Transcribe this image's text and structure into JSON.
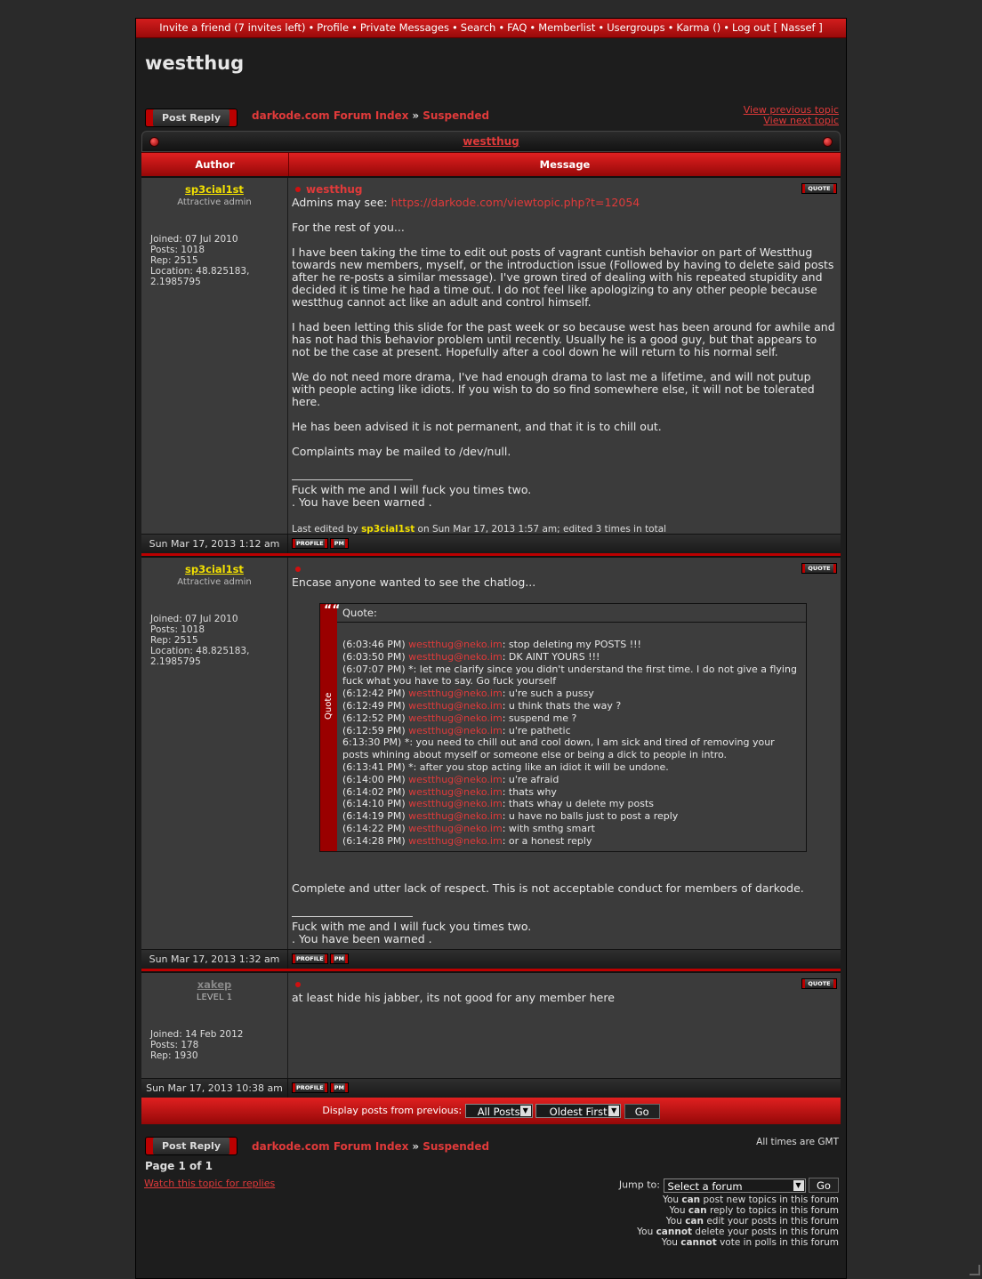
{
  "topnav": {
    "items": [
      "Invite a friend (7 invites left)",
      "Profile",
      "Private Messages",
      "Search",
      "FAQ",
      "Memberlist",
      "Usergroups",
      "Karma ()",
      "Log out [ Nassef ]"
    ]
  },
  "page_title": "westthug",
  "post_reply_label": "Post Reply",
  "breadcrumb": {
    "index": "darkode.com Forum Index",
    "forum": "Suspended",
    "sep": "»"
  },
  "nav": {
    "prev": "View previous topic",
    "next": "View next topic"
  },
  "topic_title": "westthug",
  "columns": {
    "author": "Author",
    "message": "Message"
  },
  "quote_btn": "QUOTE",
  "profile_btn": "PROFILE",
  "pm_btn": "PM",
  "posts": [
    {
      "author": "sp3cial1st",
      "rank": "Attractive admin",
      "joined": "Joined: 07 Jul 2010",
      "posts": "Posts: 1018",
      "rep": "Rep: 2515",
      "location1": "Location: 48.825183,",
      "location2": "2.1985795",
      "subject": "westthug",
      "admins_prefix": "Admins may see: ",
      "admins_link": "https://darkode.com/viewtopic.php?t=12054",
      "p1": "For the rest of you...",
      "p2": "I have been taking the time to edit out posts of vagrant cuntish behavior on part of Westthug towards new members, myself, or the introduction issue (Followed by having to delete said posts after he re-posts a similar message). I've grown tired of dealing with his repeated stupidity and decided it is time he had a time out. I do not feel like apologizing to any other people because westthug cannot act like an adult and control himself.",
      "p3": "I had been letting this slide for the past week or so because west has been around for awhile and has not had this behavior problem until recently. Usually he is a good guy, but that appears to not be the case at present. Hopefully after a cool down he will return to his normal self.",
      "p4": "We do not need more drama, I've had enough drama to last me a lifetime, and will not putup with people acting like idiots. If you wish to do so find somewhere else, it will not be tolerated here.",
      "p5": "He has been advised it is not permanent, and that it is to chill out.",
      "p6": "Complaints may be mailed to /dev/null.",
      "sig1": "Fuck with me and I will fuck you times two.",
      "sig2": ". You have been warned .",
      "edit_prefix": "Last edited by ",
      "edit_user": "sp3cial1st",
      "edit_suffix": " on Sun Mar 17, 2013 1:57 am; edited 3 times in total",
      "date": "Sun Mar 17, 2013 1:12 am"
    },
    {
      "author": "sp3cial1st",
      "rank": "Attractive admin",
      "joined": "Joined: 07 Jul 2010",
      "posts": "Posts: 1018",
      "rep": "Rep: 2515",
      "location1": "Location: 48.825183,",
      "location2": "2.1985795",
      "intro": "Encase anyone wanted to see the chatlog...",
      "quote_head": "Quote:",
      "quote_side": "Quote",
      "quote_mark": "““",
      "chat": [
        {
          "t": "(6:03:46 PM) ",
          "n": "westthug@neko.im",
          "m": ": stop deleting my POSTS !!!"
        },
        {
          "t": "(6:03:50 PM) ",
          "n": "westthug@neko.im",
          "m": ": DK AINT YOURS !!!"
        },
        {
          "t": "(6:07:07 PM) *: let me clarify since you didn't understand the first time. I do not give a flying fuck what you have to say. Go fuck yourself",
          "n": "",
          "m": ""
        },
        {
          "t": "(6:12:42 PM) ",
          "n": "westthug@neko.im",
          "m": ": u're such a pussy"
        },
        {
          "t": "(6:12:49 PM) ",
          "n": "westthug@neko.im",
          "m": ": u think thats the way ?"
        },
        {
          "t": "(6:12:52 PM) ",
          "n": "westthug@neko.im",
          "m": ": suspend me ?"
        },
        {
          "t": "(6:12:59 PM) ",
          "n": "westthug@neko.im",
          "m": ": u're pathetic"
        },
        {
          "t": "6:13:30 PM) *: you need to chill out and cool down, I am sick and tired of removing your posts whining about myself or someone else or being a dick to people in intro.",
          "n": "",
          "m": ""
        },
        {
          "t": "(6:13:41 PM) *: after you stop acting like an idiot it will be undone.",
          "n": "",
          "m": ""
        },
        {
          "t": "(6:14:00 PM) ",
          "n": "westthug@neko.im",
          "m": ": u're afraid"
        },
        {
          "t": "(6:14:02 PM) ",
          "n": "westthug@neko.im",
          "m": ": thats why"
        },
        {
          "t": "(6:14:10 PM) ",
          "n": "westthug@neko.im",
          "m": ": thats whay u delete my posts"
        },
        {
          "t": "(6:14:19 PM) ",
          "n": "westthug@neko.im",
          "m": ": u have no balls just to post a reply"
        },
        {
          "t": "(6:14:22 PM) ",
          "n": "westthug@neko.im",
          "m": ": with smthg smart"
        },
        {
          "t": "(6:14:28 PM) ",
          "n": "westthug@neko.im",
          "m": ": or a honest reply"
        }
      ],
      "outro": "Complete and utter lack of respect. This is not acceptable conduct for members of darkode.",
      "sig1": "Fuck with me and I will fuck you times two.",
      "sig2": ". You have been warned .",
      "date": "Sun Mar 17, 2013 1:32 am"
    },
    {
      "author": "xakep",
      "rank": "LEVEL 1",
      "joined": "Joined: 14 Feb 2012",
      "posts": "Posts: 178",
      "rep": "Rep: 1930",
      "text": "at least hide his jabber, its not good for any member here",
      "date": "Sun Mar 17, 2013 10:38 am"
    }
  ],
  "display": {
    "label": "Display posts from previous:",
    "posts_sel": "All Posts",
    "order_sel": "Oldest First",
    "go": "Go"
  },
  "page_of": "Page 1 of 1",
  "watch": "Watch this topic for replies",
  "all_times": "All times are GMT",
  "jump": {
    "label": "Jump to:",
    "select": "Select a forum",
    "go": "Go"
  },
  "perms": [
    {
      "a": "You ",
      "b": "can",
      "c": " post new topics in this forum"
    },
    {
      "a": "You ",
      "b": "can",
      "c": " reply to topics in this forum"
    },
    {
      "a": "You ",
      "b": "can",
      "c": " edit your posts in this forum"
    },
    {
      "a": "You ",
      "b": "cannot",
      "c": " delete your posts in this forum"
    },
    {
      "a": "You ",
      "b": "cannot",
      "c": " vote in polls in this forum"
    }
  ]
}
